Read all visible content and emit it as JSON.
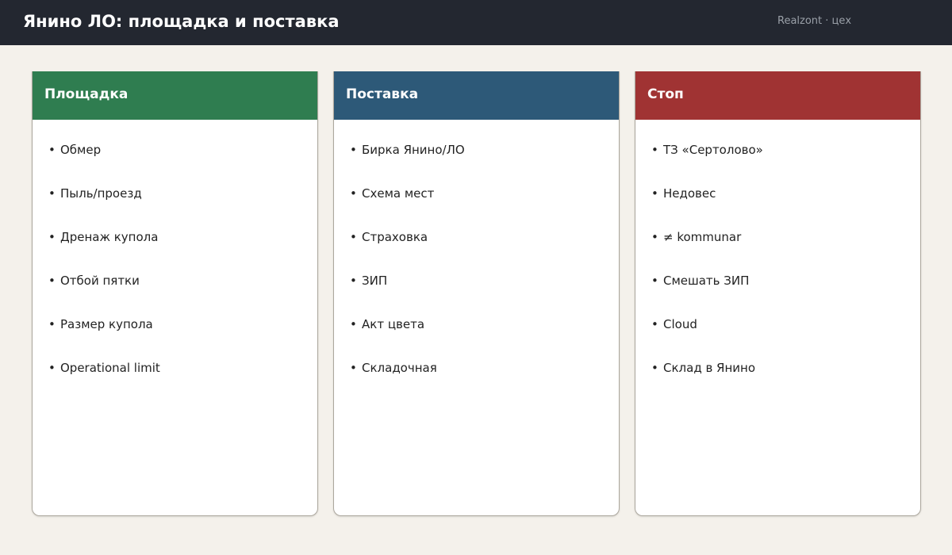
{
  "header": {
    "title": "Янино ЛО: площадка и поставка",
    "meta": "Realzont · цех"
  },
  "columns": [
    {
      "title": "Площадка",
      "color": "#2f7d50",
      "items": [
        "Обмер",
        "Пыль/проезд",
        "Дренаж купола",
        "Отбой пятки",
        "Размер купола",
        "Operational limit"
      ]
    },
    {
      "title": "Поставка",
      "color": "#2d5978",
      "items": [
        "Бирка Янино/ЛО",
        "Схема мест",
        "Страховка",
        "ЗИП",
        "Акт цвета",
        "Складочная"
      ]
    },
    {
      "title": "Стоп",
      "color": "#a03333",
      "items": [
        "ТЗ «Сертолово»",
        "Недовес",
        "≠ kommunar",
        "Смешать ЗИП",
        "Cloud",
        "Склад в Янино"
      ]
    }
  ]
}
